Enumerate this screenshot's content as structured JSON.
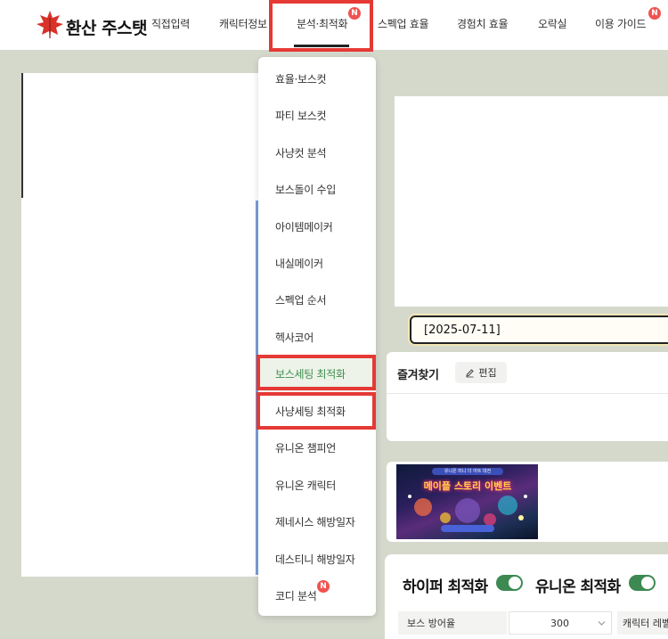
{
  "brand": {
    "logo_text": "환산 주스탯"
  },
  "nav": {
    "items": [
      {
        "label": "직접입력"
      },
      {
        "label": "캐릭터정보"
      },
      {
        "label": "분석·최적화"
      },
      {
        "label": "스펙업 효율"
      },
      {
        "label": "경험치 효율"
      },
      {
        "label": "오락실"
      },
      {
        "label": "이용 가이드"
      }
    ],
    "active": "분석·최적화",
    "badge_text": "N"
  },
  "dropdown": {
    "items": [
      {
        "label": "효율·보스컷"
      },
      {
        "label": "파티 보스컷"
      },
      {
        "label": "사냥컷 분석"
      },
      {
        "label": "보스돌이 수입"
      },
      {
        "label": "아이템메이커"
      },
      {
        "label": "내실메이커"
      },
      {
        "label": "스펙업 순서"
      },
      {
        "label": "헥사코어"
      },
      {
        "label": "보스세팅 최적화"
      },
      {
        "label": "사냥세팅 최적화"
      },
      {
        "label": "유니온 챔피언"
      },
      {
        "label": "유니온 캐릭터"
      },
      {
        "label": "제네시스 해방일자"
      },
      {
        "label": "데스티니 해방일자"
      },
      {
        "label": "코디 분석"
      }
    ],
    "selected": "보스세팅 최적화",
    "badge_text": "N"
  },
  "date_field": {
    "value": "[2025-07-11]"
  },
  "favorites": {
    "title": "즐겨찾기",
    "edit_label": "편집"
  },
  "banner": {
    "pill_text": "유니온 미니 더 아트 대전",
    "title": "메이플 스토리 이벤트"
  },
  "optimizer": {
    "hyper_label": "하이퍼 최적화",
    "union_label": "유니온 최적화",
    "hyper_on": true,
    "union_on": true,
    "boss_def_label": "보스 방어율",
    "boss_def_value": "300",
    "char_level_label": "캐릭터 레벨"
  },
  "colors": {
    "accent_green": "#3c8a52",
    "highlight_red": "#e53935",
    "badge_red": "#ef5350",
    "background": "#d5d9cc"
  }
}
